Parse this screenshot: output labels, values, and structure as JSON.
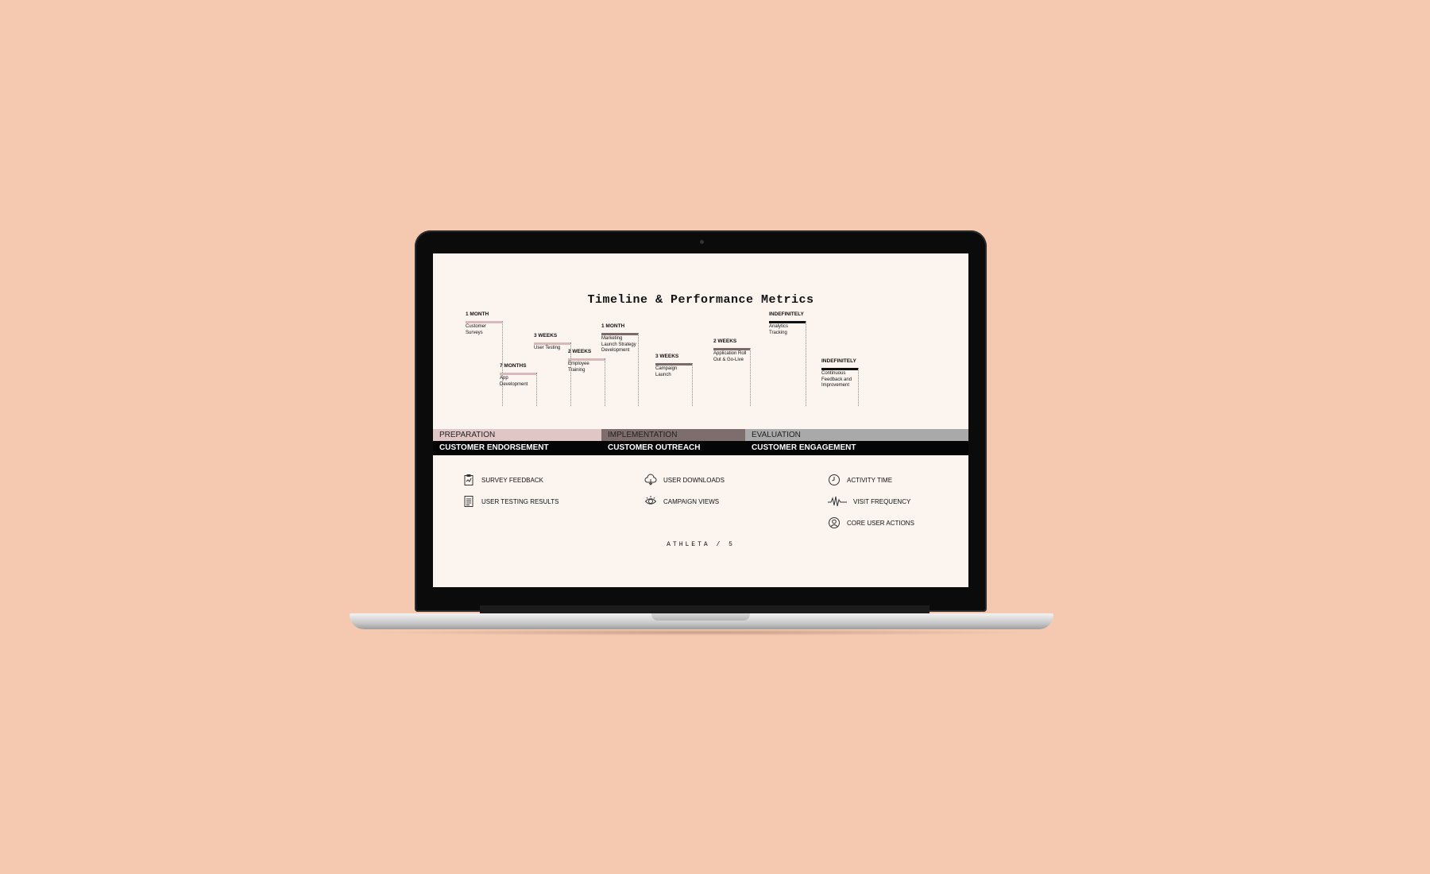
{
  "slide": {
    "title": "Timeline & Performance Metrics",
    "footer": "ATHLETA / 5"
  },
  "timeline": [
    {
      "duration": "1 MONTH",
      "label": "Customer Surveys",
      "color": "#d9b8b8"
    },
    {
      "duration": "7 MONTHS",
      "label": "App Development",
      "color": "#d9b8b8"
    },
    {
      "duration": "3 WEEKS",
      "label": "User Testing",
      "color": "#d9b8b8"
    },
    {
      "duration": "2 WEEKS",
      "label": "Employee Training",
      "color": "#d9b8b8"
    },
    {
      "duration": "1 MONTH",
      "label": "Marketing Launch Strategy Development",
      "color": "#7a6a6a"
    },
    {
      "duration": "3 WEEKS",
      "label": "Campaign Launch",
      "color": "#7a6a6a"
    },
    {
      "duration": "2 WEEKS",
      "label": "Application Roll Out & Go-Live",
      "color": "#7a6a6a"
    },
    {
      "duration": "INDEFINITELY",
      "label": "Analytics Tracking",
      "color": "#111111"
    },
    {
      "duration": "INDEFINITELY",
      "label": "Continuous Feedback and Improvement",
      "color": "#111111"
    }
  ],
  "phases": [
    {
      "name": "PREPARATION",
      "color": "#e1c6c6"
    },
    {
      "name": "IMPLEMENTATION",
      "color": "#7d6d6d"
    },
    {
      "name": "EVALUATION",
      "color": "#a9a9a9"
    }
  ],
  "categories": [
    "CUSTOMER ENDORSEMENT",
    "CUSTOMER OUTREACH",
    "CUSTOMER ENGAGEMENT"
  ],
  "metrics": [
    {
      "label": "SURVEY FEEDBACK",
      "icon": "clipboard-icon"
    },
    {
      "label": "USER TESTING RESULTS",
      "icon": "document-list-icon"
    },
    {
      "label": "USER DOWNLOADS",
      "icon": "cloud-download-icon"
    },
    {
      "label": "CAMPAIGN VIEWS",
      "icon": "eye-icon"
    },
    {
      "label": "ACTIVITY TIME",
      "icon": "clock-icon"
    },
    {
      "label": "VISIT FREQUENCY",
      "icon": "pulse-icon"
    },
    {
      "label": "CORE USER ACTIONS",
      "icon": "user-icon"
    }
  ],
  "colors": {
    "background": "#f4c9b0",
    "screen": "#fbf4ef"
  }
}
